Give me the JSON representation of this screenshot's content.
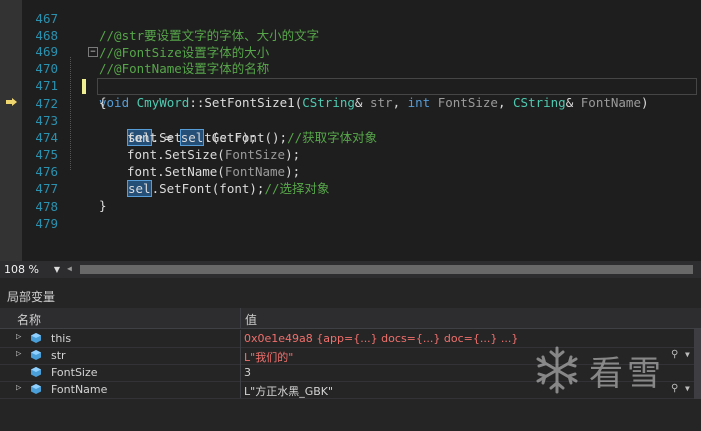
{
  "editor": {
    "zoom": "108 %",
    "lines": [
      {
        "num": "467",
        "comment": "//@str要设置文字的字体、大小的文字"
      },
      {
        "num": "468",
        "comment": "//@FontSize设置字体的大小"
      },
      {
        "num": "469",
        "comment": "//@FontName设置字体的名称"
      },
      {
        "num": "470",
        "kw_void": "void",
        "class": "CmyWord",
        "sep": "::",
        "func": "SetFontSize1",
        "open": "(",
        "t1": "CString",
        "amp1": "& ",
        "p1": "str",
        "c1": ", ",
        "kw_int": "int",
        "p2": "FontSize",
        "c2": ", ",
        "t3": "CString",
        "amp3": "& ",
        "p3": "FontName",
        "close": ")"
      },
      {
        "num": "471",
        "text": "{"
      },
      {
        "num": "472",
        "sel": "sel",
        "a": ".SetText(",
        "p": "str",
        "b": ");"
      },
      {
        "num": "473",
        "a": "font = ",
        "sel": "sel",
        "b": ".GetFont();",
        "comment": "//获取字体对象"
      },
      {
        "num": "474",
        "a": "font.SetSize(",
        "p": "FontSize",
        "b": ");"
      },
      {
        "num": "475",
        "a": "font.SetName(",
        "p": "FontName",
        "b": ");"
      },
      {
        "num": "476",
        "sel": "sel",
        "a": ".SetFont(font);",
        "comment": "//选择对象"
      },
      {
        "num": "477",
        "text": "}"
      },
      {
        "num": "478"
      },
      {
        "num": "479"
      }
    ]
  },
  "locals": {
    "title": "局部变量",
    "col_name": "名称",
    "col_value": "值",
    "rows": [
      {
        "name": "this",
        "value": "0x0e1e49a8 {app={...} docs={...} doc={...} ...}",
        "expand": "▷",
        "changed": true
      },
      {
        "name": "str",
        "value": "L\"我们的\"",
        "expand": "▷",
        "changed": true,
        "search": true
      },
      {
        "name": "FontSize",
        "value": "3",
        "expand": "",
        "changed": false
      },
      {
        "name": "FontName",
        "value": "L\"方正水黑_GBK\"",
        "expand": "▷",
        "changed": false,
        "search": true
      }
    ]
  },
  "icons": {
    "search": "magnifier-icon",
    "dropdown": "▾",
    "current_line": "arrow-icon"
  },
  "watermark": {
    "text": "看雪"
  },
  "colors": {
    "line_number": "#2b91af",
    "comment": "#57a64a",
    "keyword": "#569cd6",
    "type": "#4ec9b0",
    "param": "#9b9b9b",
    "changed_value": "#f0706c"
  }
}
